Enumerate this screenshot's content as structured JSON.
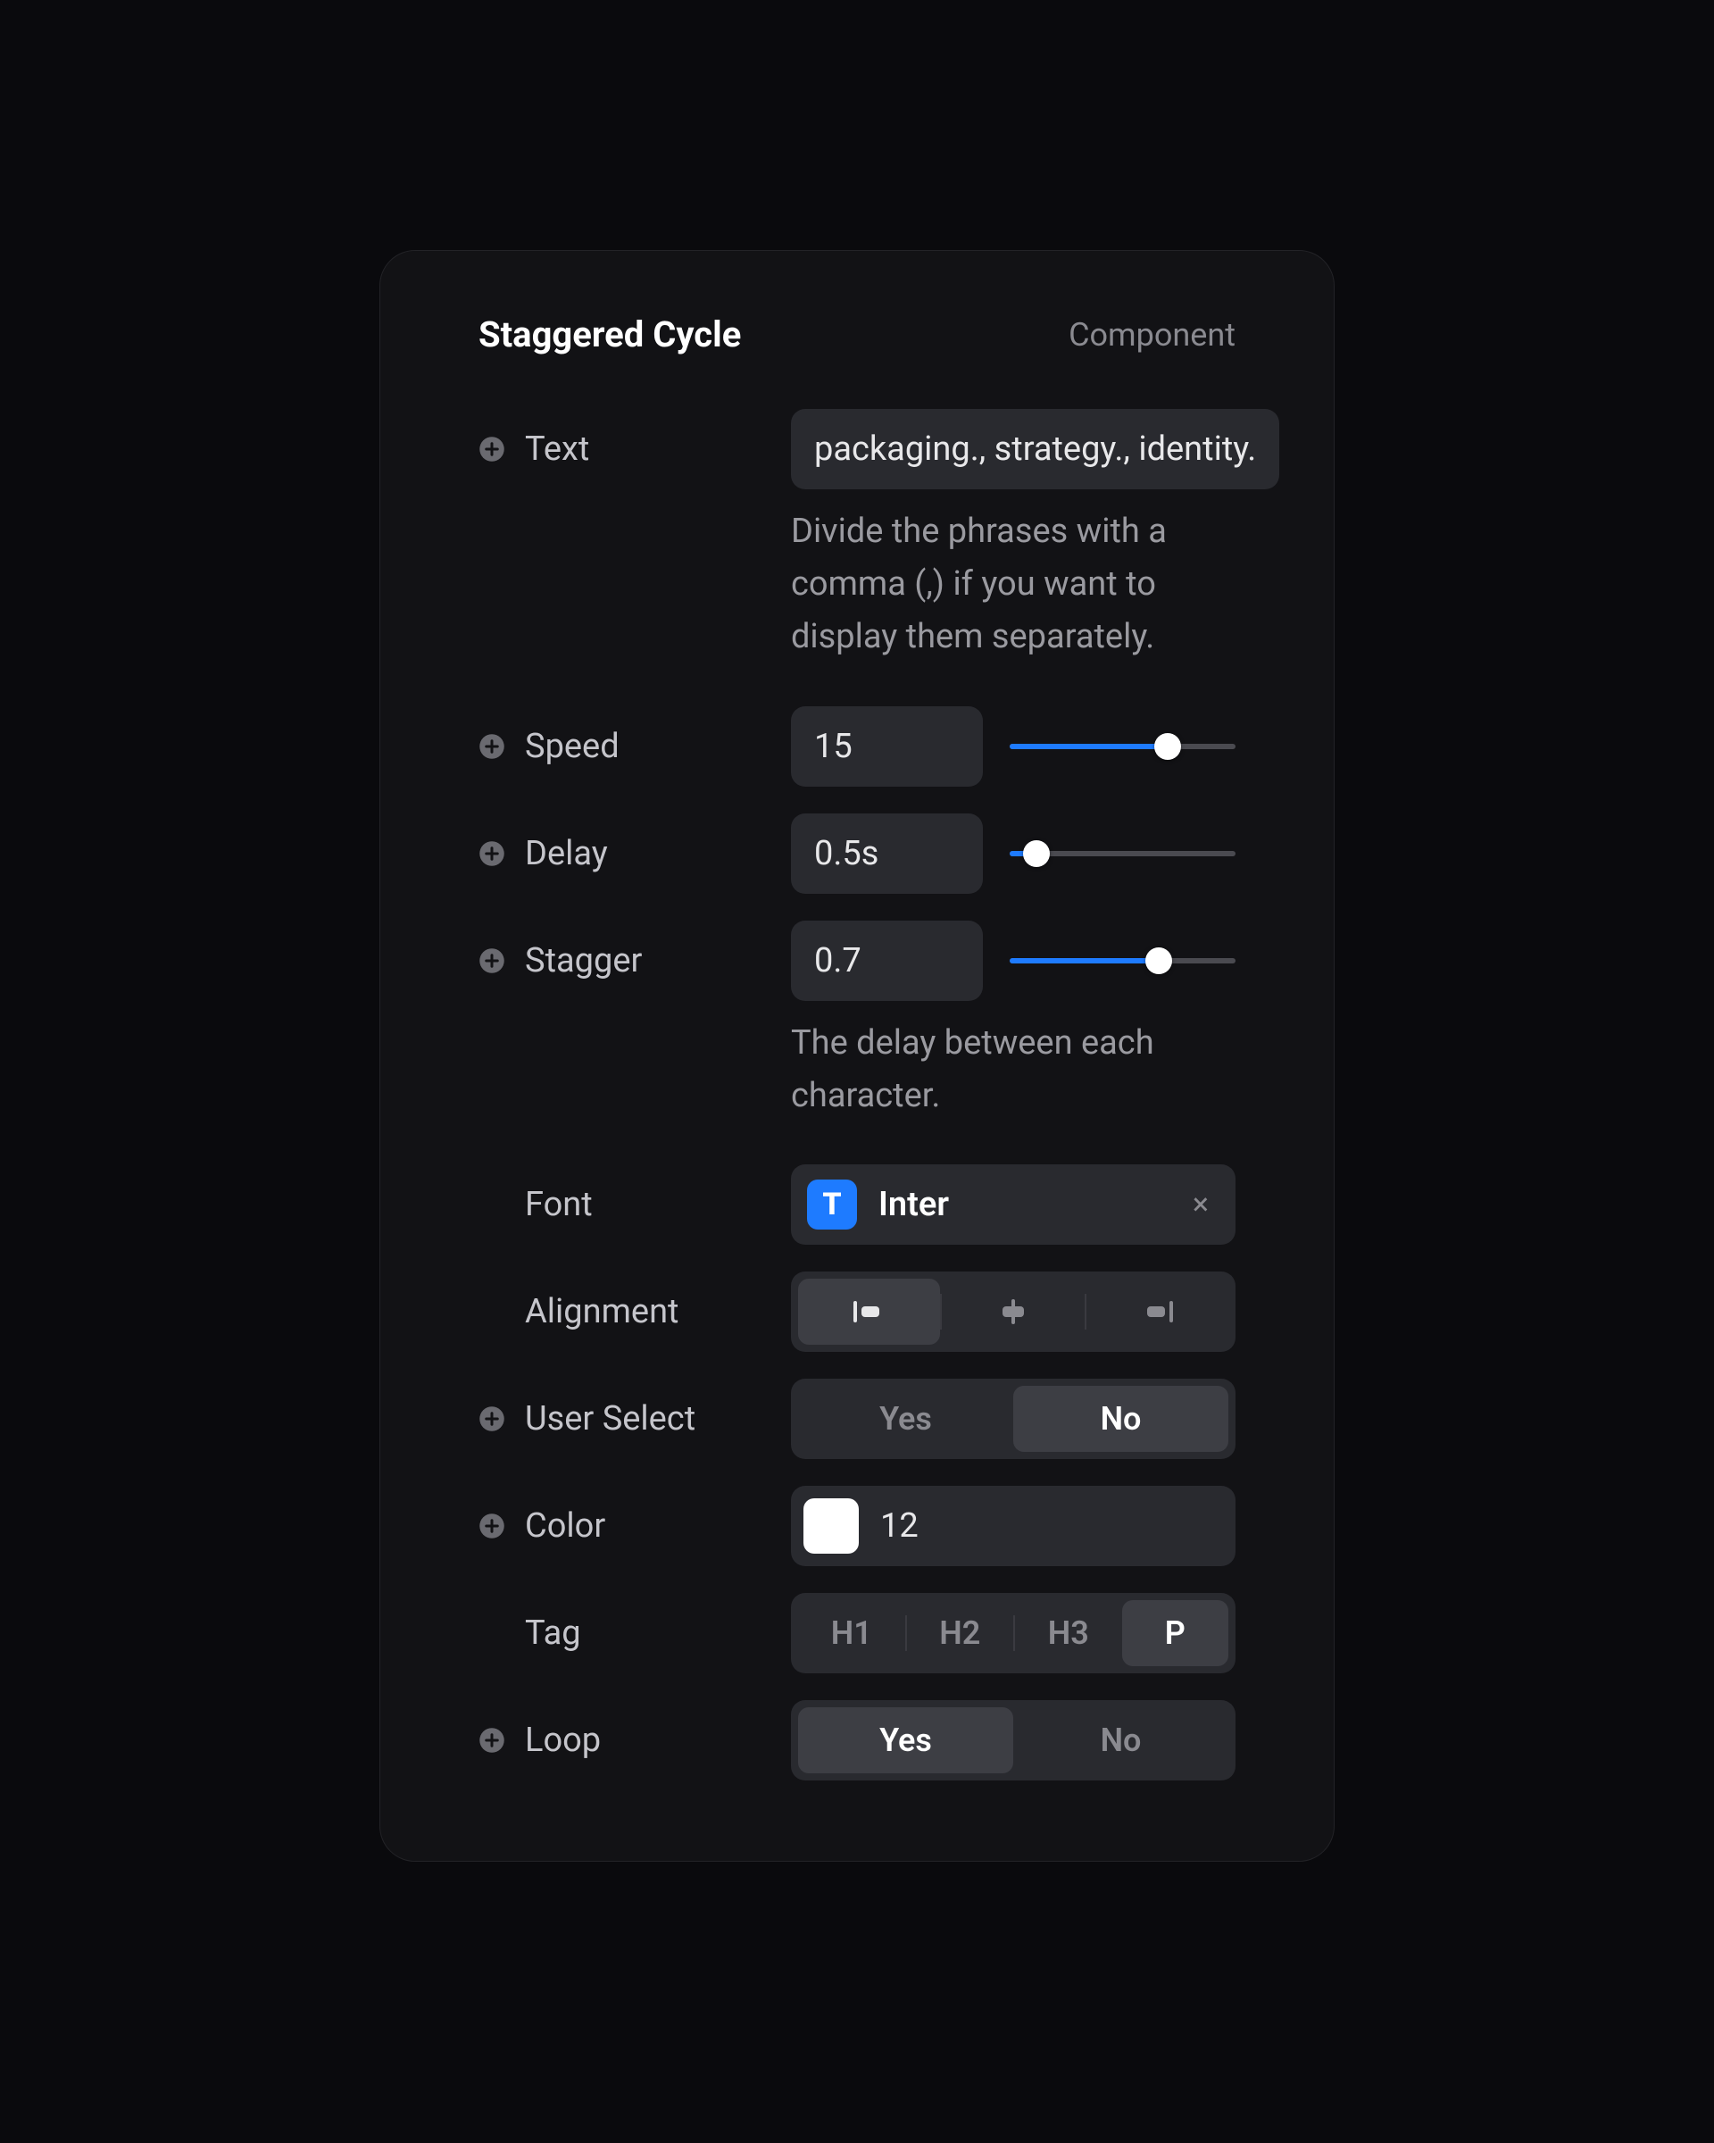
{
  "header": {
    "title": "Staggered Cycle",
    "type": "Component"
  },
  "text": {
    "label": "Text",
    "value": "packaging., strategy., identity.",
    "helper": "Divide the phrases with a comma (,) if you want to display them separately."
  },
  "speed": {
    "label": "Speed",
    "value": "15",
    "slider_percent": 70
  },
  "delay": {
    "label": "Delay",
    "value": "0.5s",
    "slider_percent": 12
  },
  "stagger": {
    "label": "Stagger",
    "value": "0.7",
    "helper": "The delay between each character.",
    "slider_percent": 66
  },
  "font": {
    "label": "Font",
    "badge": "T",
    "name": "Inter",
    "clear": "×"
  },
  "alignment": {
    "label": "Alignment",
    "options": [
      "left",
      "center",
      "right"
    ],
    "selected": "left"
  },
  "user_select": {
    "label": "User Select",
    "yes": "Yes",
    "no": "No",
    "selected": "No"
  },
  "color": {
    "label": "Color",
    "swatch": "#ffffff",
    "text": "12"
  },
  "tag": {
    "label": "Tag",
    "options": [
      "H1",
      "H2",
      "H3",
      "P"
    ],
    "selected": "P"
  },
  "loop": {
    "label": "Loop",
    "yes": "Yes",
    "no": "No",
    "selected": "Yes"
  }
}
